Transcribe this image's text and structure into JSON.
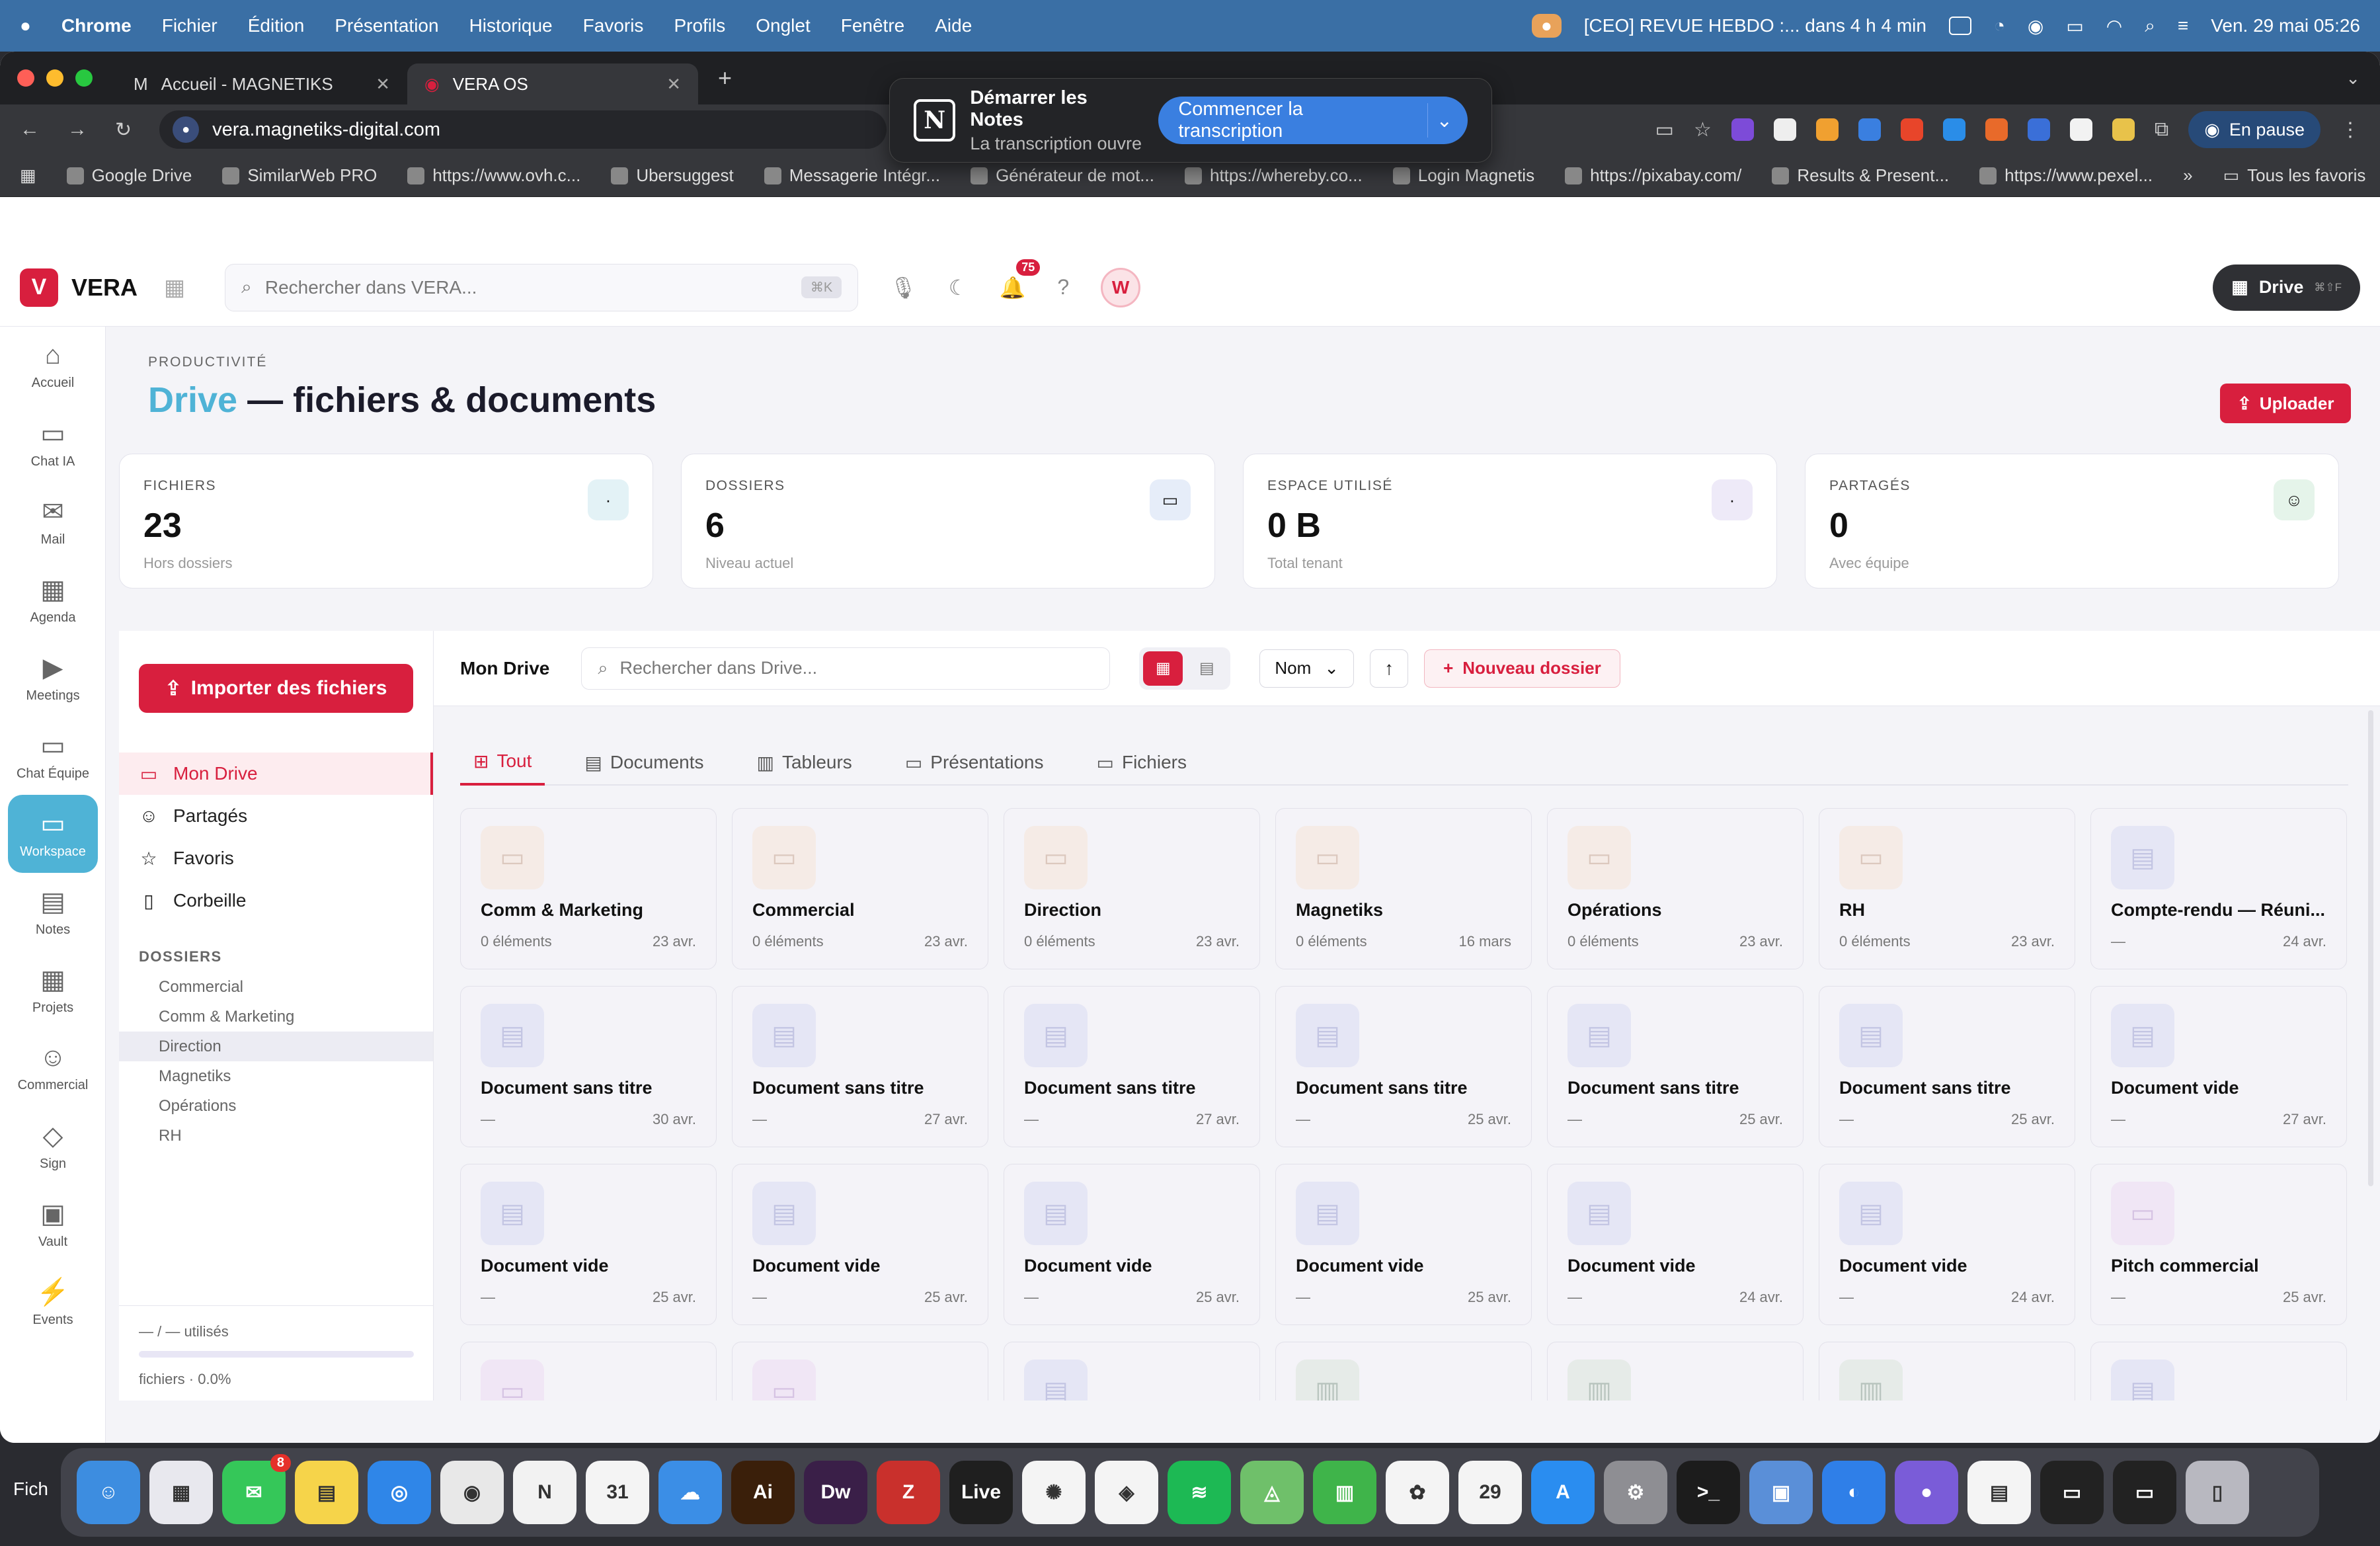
{
  "menubar": {
    "items": [
      "Chrome",
      "Fichier",
      "Édition",
      "Présentation",
      "Historique",
      "Favoris",
      "Profils",
      "Onglet",
      "Fenêtre",
      "Aide"
    ],
    "meeting": "[CEO] REVUE HEBDO :... dans 4 h 4 min",
    "datetime": "Ven. 29 mai  05:26"
  },
  "browser": {
    "tabs": [
      {
        "label": "Accueil - MAGNETIKS"
      },
      {
        "label": "VERA OS"
      }
    ],
    "url": "vera.magnetiks-digital.com",
    "profile": "En pause",
    "bookmarks": [
      "Google Drive",
      "SimilarWeb PRO",
      "https://www.ovh.c...",
      "Ubersuggest",
      "Messagerie Intégr...",
      "Générateur de mot...",
      "https://whereby.co...",
      "Login Magnetis",
      "https://pixabay.com/",
      "Results & Present...",
      "https://www.pexel..."
    ],
    "all_bookmarks": "Tous les favoris"
  },
  "notion_popup": {
    "title": "Démarrer les Notes",
    "subtitle": "La transcription ouvre",
    "button": "Commencer la transcription"
  },
  "app": {
    "brand": "VERA",
    "search_placeholder": "Rechercher dans VERA...",
    "search_shortcut": "⌘K",
    "notif_count": "75",
    "avatar": "W",
    "drive_pill": "Drive",
    "drive_pill_shortcut": "⌘⇧F"
  },
  "rail": [
    {
      "label": "Accueil",
      "icon": "⌂"
    },
    {
      "label": "Chat IA",
      "icon": "▭"
    },
    {
      "label": "Mail",
      "icon": "✉"
    },
    {
      "label": "Agenda",
      "icon": "▦"
    },
    {
      "label": "Meetings",
      "icon": "▶"
    },
    {
      "label": "Chat Équipe",
      "icon": "▭"
    },
    {
      "label": "Workspace",
      "icon": "▭"
    },
    {
      "label": "Notes",
      "icon": "▤"
    },
    {
      "label": "Projets",
      "icon": "▦"
    },
    {
      "label": "Commercial",
      "icon": "☺"
    },
    {
      "label": "Sign",
      "icon": "◇"
    },
    {
      "label": "Vault",
      "icon": "▣"
    },
    {
      "label": "Events",
      "icon": "⚡"
    }
  ],
  "page": {
    "kicker": "PRODUCTIVITÉ",
    "title_accent": "Drive",
    "title_rest": " — fichiers & documents",
    "upload": "Uploader"
  },
  "stats": [
    {
      "label": "FICHIERS",
      "value": "23",
      "sub": "Hors dossiers",
      "icon": "·",
      "color": "#e3f2f6"
    },
    {
      "label": "DOSSIERS",
      "value": "6",
      "sub": "Niveau actuel",
      "icon": "▭",
      "color": "#e6edf9"
    },
    {
      "label": "ESPACE UTILISÉ",
      "value": "0 B",
      "sub": "Total tenant",
      "icon": "·",
      "color": "#eeeaf8"
    },
    {
      "label": "PARTAGÉS",
      "value": "0",
      "sub": "Avec équipe",
      "icon": "☺",
      "color": "#e5f4ea"
    }
  ],
  "left": {
    "import": "Importer des fichiers",
    "nav": [
      {
        "label": "Mon Drive",
        "icon": "▭"
      },
      {
        "label": "Partagés",
        "icon": "☺"
      },
      {
        "label": "Favoris",
        "icon": "☆"
      },
      {
        "label": "Corbeille",
        "icon": "▯"
      }
    ],
    "dossiers_title": "DOSSIERS",
    "folders": [
      "Commercial",
      "Comm & Marketing",
      "Direction",
      "Magnetiks",
      "Opérations",
      "RH"
    ],
    "storage": "— / — utilisés",
    "storage_sub": "fichiers · 0.0%"
  },
  "toolbar": {
    "crumb": "Mon Drive",
    "search_placeholder": "Rechercher dans Drive...",
    "sort": "Nom",
    "new_folder": "Nouveau dossier"
  },
  "tabs": [
    {
      "label": "Tout",
      "icon": "⊞"
    },
    {
      "label": "Documents",
      "icon": "▤"
    },
    {
      "label": "Tableurs",
      "icon": "▥"
    },
    {
      "label": "Présentations",
      "icon": "▭"
    },
    {
      "label": "Fichiers",
      "icon": "▭"
    }
  ],
  "items": [
    {
      "name": "Comm & Marketing",
      "meta": "0 éléments",
      "date": "23 avr.",
      "kind": "folder"
    },
    {
      "name": "Commercial",
      "meta": "0 éléments",
      "date": "23 avr.",
      "kind": "folder"
    },
    {
      "name": "Direction",
      "meta": "0 éléments",
      "date": "23 avr.",
      "kind": "folder"
    },
    {
      "name": "Magnetiks",
      "meta": "0 éléments",
      "date": "16 mars",
      "kind": "folder"
    },
    {
      "name": "Opérations",
      "meta": "0 éléments",
      "date": "23 avr.",
      "kind": "folder"
    },
    {
      "name": "RH",
      "meta": "0 éléments",
      "date": "23 avr.",
      "kind": "folder"
    },
    {
      "name": "Compte-rendu — Réuni...",
      "meta": "—",
      "date": "24 avr.",
      "kind": "doc"
    },
    {
      "name": "Document sans titre",
      "meta": "—",
      "date": "30 avr.",
      "kind": "doc"
    },
    {
      "name": "Document sans titre",
      "meta": "—",
      "date": "27 avr.",
      "kind": "doc"
    },
    {
      "name": "Document sans titre",
      "meta": "—",
      "date": "27 avr.",
      "kind": "doc"
    },
    {
      "name": "Document sans titre",
      "meta": "—",
      "date": "25 avr.",
      "kind": "doc"
    },
    {
      "name": "Document sans titre",
      "meta": "—",
      "date": "25 avr.",
      "kind": "doc"
    },
    {
      "name": "Document sans titre",
      "meta": "—",
      "date": "25 avr.",
      "kind": "doc"
    },
    {
      "name": "Document vide",
      "meta": "—",
      "date": "27 avr.",
      "kind": "doc"
    },
    {
      "name": "Document vide",
      "meta": "—",
      "date": "25 avr.",
      "kind": "doc"
    },
    {
      "name": "Document vide",
      "meta": "—",
      "date": "25 avr.",
      "kind": "doc"
    },
    {
      "name": "Document vide",
      "meta": "—",
      "date": "25 avr.",
      "kind": "doc"
    },
    {
      "name": "Document vide",
      "meta": "—",
      "date": "25 avr.",
      "kind": "doc"
    },
    {
      "name": "Document vide",
      "meta": "—",
      "date": "24 avr.",
      "kind": "doc"
    },
    {
      "name": "Document vide",
      "meta": "—",
      "date": "24 avr.",
      "kind": "doc"
    },
    {
      "name": "Pitch commercial",
      "meta": "—",
      "date": "25 avr.",
      "kind": "pres"
    },
    {
      "name": "",
      "meta": "",
      "date": "",
      "kind": "pres"
    },
    {
      "name": "",
      "meta": "",
      "date": "",
      "kind": "pres"
    },
    {
      "name": "",
      "meta": "",
      "date": "",
      "kind": "doc"
    },
    {
      "name": "",
      "meta": "",
      "date": "",
      "kind": "sheet"
    },
    {
      "name": "",
      "meta": "",
      "date": "",
      "kind": "sheet"
    },
    {
      "name": "",
      "meta": "",
      "date": "",
      "kind": "sheet"
    },
    {
      "name": "",
      "meta": "",
      "date": "",
      "kind": "doc"
    }
  ],
  "dock": {
    "left_label": "Fich",
    "items": [
      {
        "name": "Finder",
        "icon": "☺",
        "color": "#3d8de0"
      },
      {
        "name": "Launchpad",
        "icon": "▦",
        "color": "#e8e8ee"
      },
      {
        "name": "Messages",
        "icon": "✉",
        "color": "#35c759",
        "badge": "8"
      },
      {
        "name": "Notes",
        "icon": "▤",
        "color": "#f6d44a"
      },
      {
        "name": "Safari",
        "icon": "◎",
        "color": "#2f86e8"
      },
      {
        "name": "Chrome",
        "icon": "◉",
        "color": "#e8e8e8"
      },
      {
        "name": "Notion",
        "icon": "N",
        "color": "#f2f2f2"
      },
      {
        "name": "Calendrier",
        "icon": "31",
        "color": "#f4f4f4"
      },
      {
        "name": "Météo",
        "icon": "☁",
        "color": "#3b8ee6"
      },
      {
        "name": "Illustrator",
        "icon": "Ai",
        "color": "#3a1f0a"
      },
      {
        "name": "Dreamweaver",
        "icon": "Dw",
        "color": "#3a1f48"
      },
      {
        "name": "FileZilla",
        "icon": "Z",
        "color": "#c9302c"
      },
      {
        "name": "Live",
        "icon": "Live",
        "color": "#1f1f1f"
      },
      {
        "name": "ChatGPT",
        "icon": "✺",
        "color": "#f4f4f4"
      },
      {
        "name": "Blender",
        "icon": "◈",
        "color": "#f4f4f4"
      },
      {
        "name": "Spotify",
        "icon": "≋",
        "color": "#1db954"
      },
      {
        "name": "Plans",
        "icon": "◬",
        "color": "#6fc06a"
      },
      {
        "name": "Numbers",
        "icon": "▥",
        "color": "#3fb44a"
      },
      {
        "name": "Photos",
        "icon": "✿",
        "color": "#f4f4f4"
      },
      {
        "name": "Calendrier",
        "icon": "29",
        "color": "#f4f4f4"
      },
      {
        "name": "App Store",
        "icon": "A",
        "color": "#2a8df0"
      },
      {
        "name": "Réglages",
        "icon": "⚙",
        "color": "#8e8e93"
      },
      {
        "name": "Terminal",
        "icon": ">_",
        "color": "#1c1c1c"
      },
      {
        "name": "Outil",
        "icon": "▣",
        "color": "#5a8fd8"
      },
      {
        "name": "Loupe",
        "icon": "◐",
        "color": "#2f7fe8"
      },
      {
        "name": "Siri",
        "icon": "●",
        "color": "#7a5cd8"
      },
      {
        "name": "Document",
        "icon": "▤",
        "color": "#f4f4f4"
      },
      {
        "name": "Fenêtre",
        "icon": "▭",
        "color": "#222"
      },
      {
        "name": "Fenêtre 2",
        "icon": "▭",
        "color": "#222"
      },
      {
        "name": "Corbeille",
        "icon": "▯",
        "color": "#b8b8c0"
      }
    ]
  }
}
